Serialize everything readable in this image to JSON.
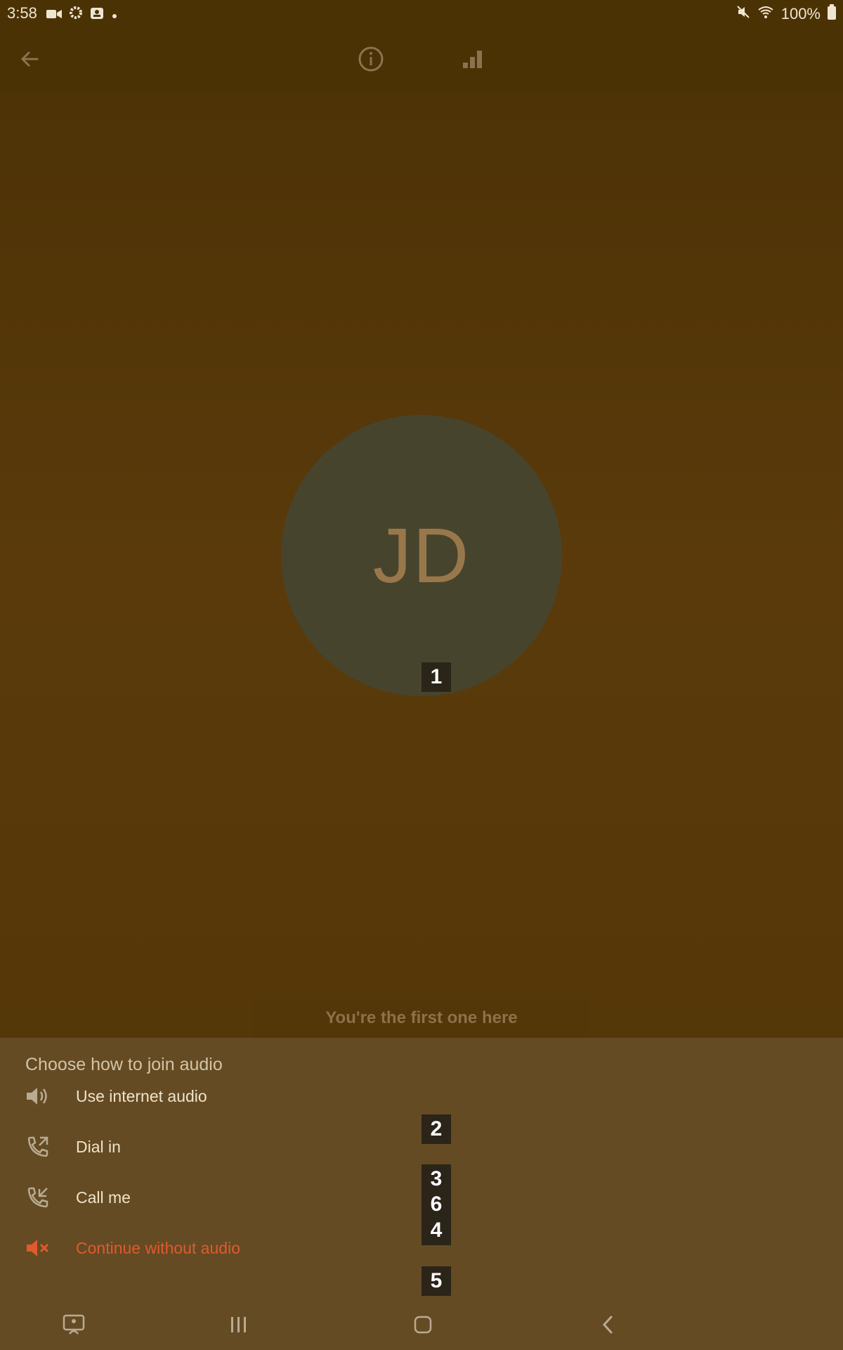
{
  "status_bar": {
    "time": "3:58",
    "battery": "100%",
    "icons": [
      "video-icon",
      "gear-icon",
      "portrait-icon",
      "dot-icon",
      "mute-icon",
      "wifi-icon",
      "battery-icon"
    ]
  },
  "toolbar": {
    "icons": [
      "back-arrow-icon",
      "info-icon",
      "signal-bars-icon"
    ]
  },
  "stage": {
    "avatar_initials": "JD",
    "first_here_text": "You're the first one here"
  },
  "audio_sheet": {
    "title": "Choose how to join audio",
    "options": [
      {
        "label": "Use internet audio",
        "icon": "speaker-icon"
      },
      {
        "label": "Dial in",
        "icon": "phone-outgoing-icon"
      },
      {
        "label": "Call me",
        "icon": "phone-incoming-icon"
      },
      {
        "label": "Continue without audio",
        "icon": "speaker-muted-icon"
      }
    ]
  },
  "markers": [
    "1",
    "2",
    "3",
    "6",
    "4",
    "5"
  ],
  "colors": {
    "accent_danger": "#e05a2b",
    "sheet_bg": "#644b24",
    "avatar_bg": "#47442e"
  },
  "nav_bar": {
    "icons": [
      "screen-share-icon",
      "recents-icon",
      "home-icon",
      "back-chevron-icon"
    ]
  }
}
